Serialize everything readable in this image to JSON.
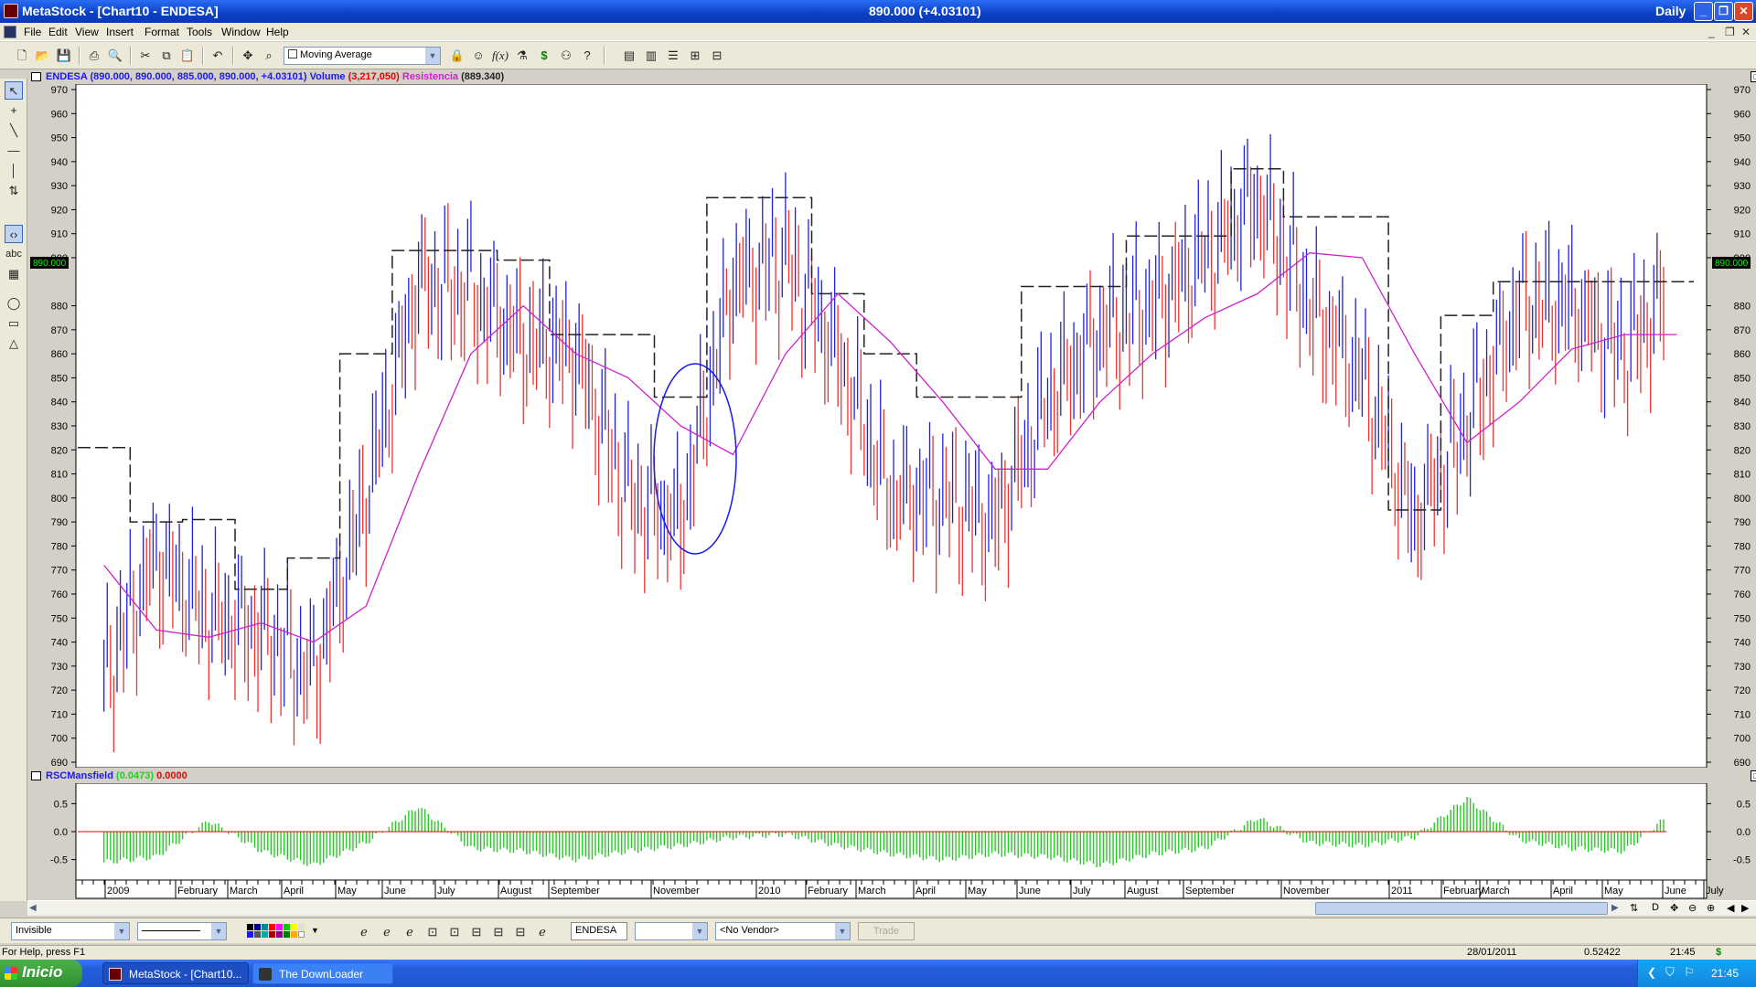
{
  "window": {
    "title": "MetaStock - [Chart10 - ENDESA]",
    "center_title": "890.000 (+4.03101)",
    "periodicity": "Daily"
  },
  "menu": [
    "File",
    "Edit",
    "View",
    "Insert",
    "Format",
    "Tools",
    "Window",
    "Help"
  ],
  "toolbar": {
    "indicator_combo": "Moving Average"
  },
  "price_pane": {
    "header_security": "ENDESA",
    "header_values": "(890.000, 890.000, 885.000, 890.000, +4.03101)",
    "header_volume_label": "Volume",
    "header_volume_value": "(3,217,050)",
    "header_resist_label": "Resistencia",
    "header_resist_value": "(889.340)",
    "last_price_label": "890.000",
    "y_ticks": [
      970,
      960,
      950,
      940,
      930,
      920,
      910,
      900,
      880,
      870,
      860,
      850,
      840,
      830,
      820,
      810,
      800,
      790,
      780,
      770,
      760,
      750,
      740,
      730,
      720,
      710,
      700,
      690
    ]
  },
  "rsc_pane": {
    "header_name": "RSCMansfield",
    "header_value1": "(0.0473)",
    "header_value2": "0.0000",
    "y_ticks": [
      "0.5",
      "0.0",
      "-0.5"
    ]
  },
  "x_axis_labels": [
    "2009",
    "February",
    "March",
    "April",
    "May",
    "June",
    "July",
    "August",
    "September",
    "November",
    "2010",
    "February",
    "March",
    "April",
    "May",
    "June",
    "July",
    "August",
    "September",
    "November",
    "2011",
    "February",
    "March",
    "April",
    "May",
    "June",
    "July"
  ],
  "bottom_toolbar": {
    "line_style_combo": "Invisible",
    "security_field": "ENDESA",
    "vendor_combo": "<No Vendor>",
    "trade_button": "Trade"
  },
  "status_bar": {
    "help_text": "For Help, press F1",
    "date": "28/01/2011",
    "value": "0.52422",
    "time": "21:45"
  },
  "taskbar": {
    "start_label": "Inicio",
    "tasks": [
      "MetaStock - [Chart10...",
      "The DownLoader"
    ],
    "clock": "21:45"
  },
  "colors": {
    "up_bar": "#2222dd",
    "down_bar": "#ee3333",
    "moving_average": "#cc22cc",
    "rsc_histogram": "#22cc22",
    "resistance_line": "#222222",
    "annotation_ellipse": "#1a1aee"
  },
  "chart_data": [
    {
      "type": "line",
      "title": "ENDESA",
      "series": [
        {
          "name": "ENDESA",
          "x": [
            "2009-01",
            "2009-02",
            "2009-03",
            "2009-04",
            "2009-05",
            "2009-06",
            "2009-07",
            "2009-08",
            "2009-09",
            "2009-10",
            "2009-11",
            "2009-12",
            "2010-01",
            "2010-02",
            "2010-03",
            "2010-04",
            "2010-05",
            "2010-06",
            "2010-07",
            "2010-08",
            "2010-09",
            "2010-10",
            "2010-11",
            "2010-12",
            "2011-01",
            "2011-02",
            "2011-03",
            "2011-04",
            "2011-05",
            "2011-06",
            "2011-07"
          ],
          "y": [
            725,
            775,
            750,
            745,
            725,
            800,
            890,
            885,
            865,
            860,
            800,
            790,
            890,
            900,
            860,
            800,
            800,
            790,
            840,
            870,
            880,
            900,
            925,
            880,
            850,
            790,
            830,
            880,
            880,
            860,
            890
          ]
        },
        {
          "name": "Moving Average",
          "x": [
            "2009-01",
            "2009-02",
            "2009-03",
            "2009-04",
            "2009-05",
            "2009-06",
            "2009-07",
            "2009-08",
            "2009-09",
            "2009-10",
            "2009-11",
            "2009-12",
            "2010-01",
            "2010-02",
            "2010-03",
            "2010-04",
            "2010-05",
            "2010-06",
            "2010-07",
            "2010-08",
            "2010-09",
            "2010-10",
            "2010-11",
            "2010-12",
            "2011-01",
            "2011-02",
            "2011-03",
            "2011-04",
            "2011-05",
            "2011-06",
            "2011-07"
          ],
          "y": [
            772,
            745,
            742,
            748,
            740,
            755,
            810,
            860,
            880,
            860,
            850,
            830,
            818,
            860,
            885,
            865,
            840,
            812,
            812,
            840,
            860,
            875,
            885,
            902,
            900,
            860,
            823,
            840,
            862,
            868,
            868
          ]
        },
        {
          "name": "Resistencia",
          "x": [
            "2009-01",
            "2009-02",
            "2009-03",
            "2009-04",
            "2009-05",
            "2009-06",
            "2009-07",
            "2009-08",
            "2009-09",
            "2009-10",
            "2009-11",
            "2009-12",
            "2010-01",
            "2010-02",
            "2010-03",
            "2010-04",
            "2010-05",
            "2010-06",
            "2010-07",
            "2010-08",
            "2010-09",
            "2010-10",
            "2010-11",
            "2010-12",
            "2011-01",
            "2011-02",
            "2011-03",
            "2011-04",
            "2011-05",
            "2011-06",
            "2011-07"
          ],
          "y": [
            821,
            790,
            791,
            762,
            775,
            860,
            903,
            903,
            899,
            868,
            868,
            842,
            925,
            925,
            885,
            860,
            842,
            842,
            888,
            888,
            909,
            909,
            937,
            917,
            917,
            795,
            876,
            890,
            890,
            890,
            890
          ]
        }
      ],
      "ylim": [
        690,
        970
      ]
    },
    {
      "type": "bar",
      "title": "RSCMansfield",
      "categories": [
        "2009-01",
        "2009-02",
        "2009-03",
        "2009-04",
        "2009-05",
        "2009-06",
        "2009-07",
        "2009-08",
        "2009-09",
        "2009-10",
        "2009-11",
        "2009-12",
        "2010-01",
        "2010-02",
        "2010-03",
        "2010-04",
        "2010-05",
        "2010-06",
        "2010-07",
        "2010-08",
        "2010-09",
        "2010-10",
        "2010-11",
        "2010-12",
        "2011-01",
        "2011-02",
        "2011-03",
        "2011-04",
        "2011-05",
        "2011-06",
        "2011-07"
      ],
      "values": [
        -0.55,
        -0.45,
        0.2,
        -0.35,
        -0.6,
        -0.2,
        0.45,
        -0.3,
        -0.35,
        -0.5,
        -0.35,
        -0.25,
        -0.1,
        -0.05,
        -0.25,
        -0.4,
        -0.5,
        -0.4,
        -0.45,
        -0.6,
        -0.4,
        -0.3,
        0.25,
        -0.2,
        -0.25,
        -0.1,
        0.6,
        -0.15,
        -0.3,
        -0.35,
        0.4
      ],
      "ylim": [
        -0.8,
        0.8
      ]
    }
  ]
}
